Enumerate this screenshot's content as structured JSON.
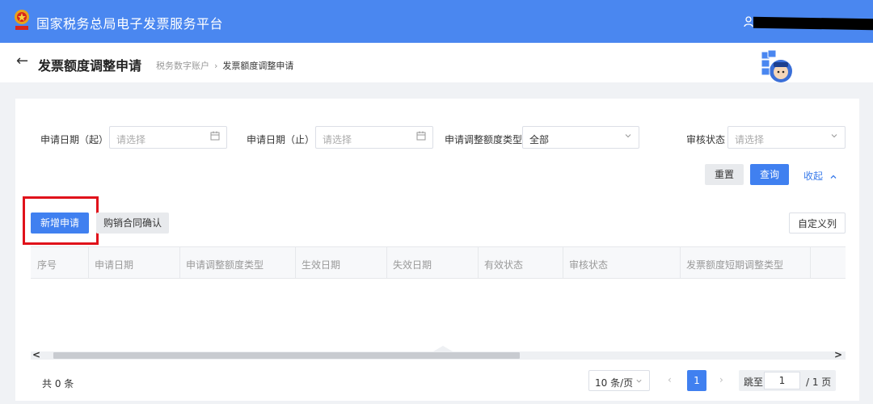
{
  "header": {
    "app_title": "国家税务总局电子发票服务平台",
    "brand_color": "#4a87f0"
  },
  "subheader": {
    "page_title": "发票额度调整申请",
    "breadcrumb": [
      "税务数字账户",
      "发票额度调整申请"
    ]
  },
  "filters": {
    "start_date_label": "申请日期（起）",
    "start_date_placeholder": "请选择",
    "end_date_label": "申请日期（止）",
    "end_date_placeholder": "请选择",
    "type_label": "申请调整额度类型",
    "type_value": "全部",
    "status_label": "审核状态",
    "status_placeholder": "请选择"
  },
  "actions": {
    "reset": "重置",
    "search": "查询",
    "collapse": "收起"
  },
  "toolbar": {
    "new_application": "新增申请",
    "contract_confirm": "购销合同确认",
    "custom_columns": "自定义列"
  },
  "table": {
    "columns": [
      "序号",
      "申请日期",
      "申请调整额度类型",
      "生效日期",
      "失效日期",
      "有效状态",
      "审核状态",
      "发票额度短期调整类型"
    ],
    "rows": []
  },
  "pagination": {
    "total": "共 0 条",
    "page_size": "10 条/页",
    "current_page": "1",
    "jump_label": "跳至",
    "jump_value": "1",
    "total_pages": "/ 1 页",
    "accent_color": "#4080f0"
  }
}
